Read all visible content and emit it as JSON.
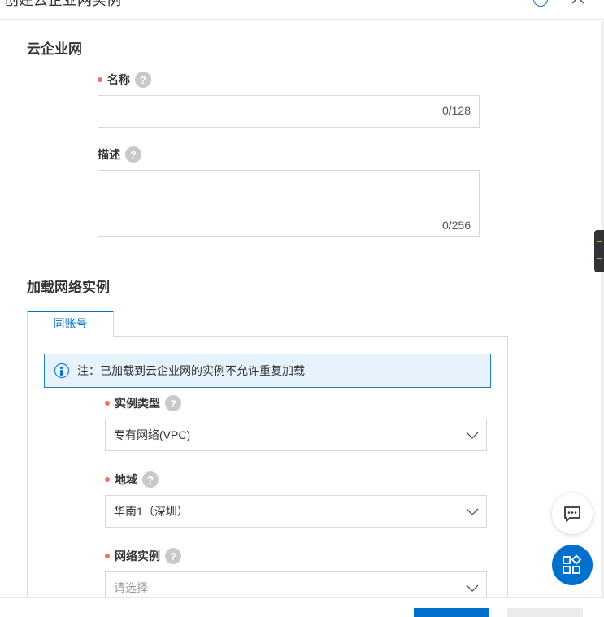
{
  "header": {
    "title": "创建云企业网实例",
    "help_icon": "info-icon",
    "close_icon": "close-icon"
  },
  "cen_section": {
    "title": "云企业网",
    "name_field": {
      "label": "名称",
      "value": "",
      "counter": "0/128",
      "required": true
    },
    "desc_field": {
      "label": "描述",
      "value": "",
      "counter": "0/256",
      "required": false
    },
    "help_mark": "?"
  },
  "attach_section": {
    "title": "加载网络实例",
    "tabs": [
      {
        "label": "同账号",
        "active": true
      }
    ],
    "notice": {
      "icon": "info-icon",
      "text": "注：已加载到云企业网的实例不允许重复加载"
    },
    "instance_type": {
      "label": "实例类型",
      "value": "专有网络(VPC)",
      "required": true
    },
    "region": {
      "label": "地域",
      "value": "华南1（深圳）",
      "required": true
    },
    "network_instance": {
      "label": "网络实例",
      "placeholder": "请选择",
      "required": true
    }
  },
  "floating": {
    "chat_icon": "chat-icon",
    "apps_icon": "apps-icon"
  },
  "colors": {
    "accent": "#0070cc",
    "required_dot": "#f0706a",
    "notice_bg": "#e6f3fc",
    "notice_border": "#1b7fb8"
  }
}
